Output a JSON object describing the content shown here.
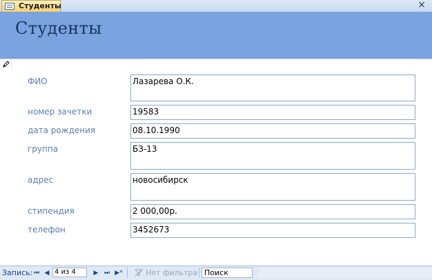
{
  "tab": {
    "label": "Студенты",
    "icon": "form-icon",
    "close": "×"
  },
  "header": {
    "title": "Студенты"
  },
  "record_selector": {
    "icon": "pencil-icon"
  },
  "fields": [
    {
      "name": "fio",
      "label": "ФИО",
      "value": "Лазарева О.К."
    },
    {
      "name": "gradebook",
      "label": "номер зачетки",
      "value": "19583"
    },
    {
      "name": "birthdate",
      "label": "дата рождения",
      "value": "08.10.1990"
    },
    {
      "name": "group",
      "label": "группа",
      "value": "БЗ-13"
    },
    {
      "name": "address",
      "label": "адрес",
      "value": "новосибирск"
    },
    {
      "name": "stipend",
      "label": "стипендия",
      "value": "2 000,00р."
    },
    {
      "name": "phone",
      "label": "телефон",
      "value": "3452673"
    }
  ],
  "navigation": {
    "label": "Запись:",
    "counter": "4 из 4",
    "filter": "Нет фильтра",
    "search_placeholder": "Поиск",
    "buttons": {
      "first": "⏮",
      "prev": "◀",
      "next": "▶",
      "last": "⏭",
      "new": "▶*"
    }
  },
  "colors": {
    "header_bg": "#7ba3df",
    "title": "#17365d",
    "label": "#5a7fae",
    "field_border": "#8aa7c8"
  }
}
